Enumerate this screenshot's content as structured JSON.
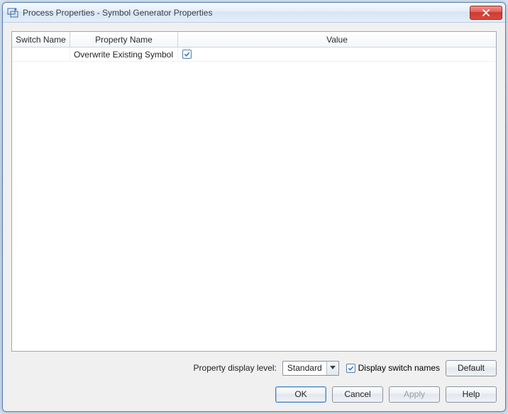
{
  "window": {
    "title": "Process Properties - Symbol Generator Properties"
  },
  "grid": {
    "headers": {
      "switch": "Switch Name",
      "property": "Property Name",
      "value": "Value"
    },
    "rows": [
      {
        "switch": "",
        "property": "Overwrite Existing Symbol",
        "value_checked": true
      }
    ]
  },
  "options": {
    "display_level_label": "Property display level:",
    "display_level_value": "Standard",
    "display_switch_names_label": "Display switch names",
    "display_switch_names_checked": true
  },
  "buttons": {
    "default": "Default",
    "ok": "OK",
    "cancel": "Cancel",
    "apply": "Apply",
    "help": "Help"
  }
}
